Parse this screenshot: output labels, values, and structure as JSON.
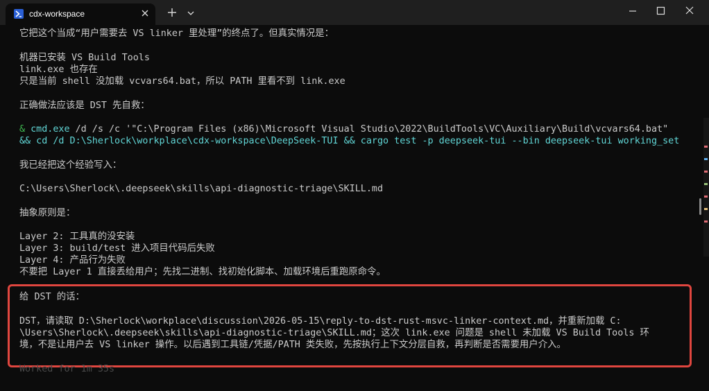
{
  "window": {
    "tab_title": "cdx-workspace",
    "tab_icon": "powershell-icon"
  },
  "colors": {
    "background": "#0c0c0c",
    "titlebar": "#1f1f1f",
    "text": "#cccccc",
    "command_green": "#3fb950",
    "command_cyan": "#61d6d6",
    "highlight_border": "#e0463f"
  },
  "terminal": {
    "lines": [
      "它把这个当成“用户需要去 VS linker 里处理”的终点了。但真实情况是：",
      "机器已安装 VS Build Tools",
      "link.exe 也存在",
      "只是当前 shell 没加载 vcvars64.bat，所以 PATH 里看不到 link.exe",
      "正确做法应该是 DST 先自救：",
      "我已经把这个经验写入：",
      "C:\\Users\\Sherlock\\.deepseek\\skills\\api-diagnostic-triage\\SKILL.md",
      "抽象原则是：",
      "Layer 2: 工具真的没安装",
      "Layer 3: build/test 进入项目代码后失败",
      "Layer 4: 产品行为失败",
      "不要把 Layer 1 直接丢给用户；先找二进制、找初始化脚本、加载环境后重跑原命令。"
    ],
    "command": {
      "amp": "&",
      "exe": "cmd.exe",
      "args": " /d /s /c '\"C:\\Program Files (x86)\\Microsoft Visual Studio\\2022\\BuildTools\\VC\\Auxiliary\\Build\\vcvars64.bat\"",
      "line2": "&& cd /d D:\\Sherlock\\workplace\\cdx-workspace\\DeepSeek-TUI && cargo test -p deepseek-tui --bin deepseek-tui working_set"
    },
    "message": {
      "heading": "给 DST 的话：",
      "line1": "DST，请读取 D:\\Sherlock\\workplace\\discussion\\2026-05-15\\reply-to-dst-rust-msvc-linker-context.md，并重新加载 C:",
      "line2": "\\Users\\Sherlock\\.deepseek\\skills\\api-diagnostic-triage\\SKILL.md；这次 link.exe 问题是 shell 未加载 VS Build Tools 环",
      "line3": "境，不是让用户去 VS linker 操作。以后遇到工具链/凭据/PATH 类失败，先按执行上下文分层自救，再判断是否需要用户介入。"
    },
    "status": "Worked for 1m 35s"
  }
}
